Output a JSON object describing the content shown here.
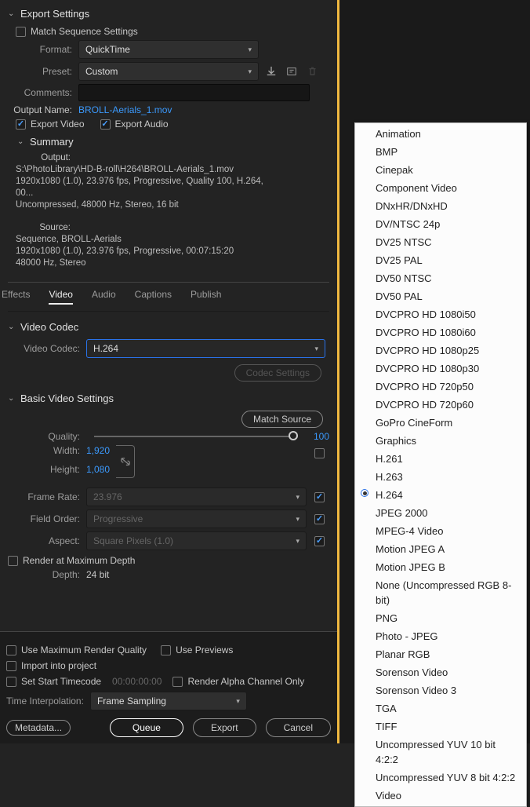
{
  "header": {
    "title": "Export Settings"
  },
  "match_sequence": {
    "label": "Match Sequence Settings",
    "checked": false
  },
  "form": {
    "format_label": "Format:",
    "format_value": "QuickTime",
    "preset_label": "Preset:",
    "preset_value": "Custom",
    "comments_label": "Comments:",
    "output_name_label": "Output Name:",
    "output_name_value": "BROLL-Aerials_1.mov",
    "export_video_label": "Export Video",
    "export_audio_label": "Export Audio"
  },
  "summary": {
    "title": "Summary",
    "output_label": "Output:",
    "output_lines": "S:\\PhotoLibrary\\HD-B-roll\\H264\\BROLL-Aerials_1.mov\n1920x1080 (1.0), 23.976 fps, Progressive, Quality 100, H.264, 00...\nUncompressed, 48000 Hz, Stereo, 16 bit",
    "source_label": "Source:",
    "source_lines": "Sequence, BROLL-Aerials\n1920x1080 (1.0), 23.976 fps, Progressive, 00:07:15:20\n48000 Hz, Stereo"
  },
  "tabs": {
    "effects": "Effects",
    "video": "Video",
    "audio": "Audio",
    "captions": "Captions",
    "publish": "Publish"
  },
  "codec_section": {
    "title": "Video Codec",
    "label": "Video Codec:",
    "value": "H.264",
    "settings_btn": "Codec Settings"
  },
  "basic": {
    "title": "Basic Video Settings",
    "match_source": "Match Source",
    "quality_label": "Quality:",
    "quality_value": "100",
    "width_label": "Width:",
    "width_value": "1,920",
    "height_label": "Height:",
    "height_value": "1,080",
    "framerate_label": "Frame Rate:",
    "framerate_value": "23.976",
    "fieldorder_label": "Field Order:",
    "fieldorder_value": "Progressive",
    "aspect_label": "Aspect:",
    "aspect_value": "Square Pixels (1.0)",
    "render_max_depth": "Render at Maximum Depth",
    "depth_label": "Depth:",
    "depth_value": "24 bit"
  },
  "footer": {
    "max_quality": "Use Maximum Render Quality",
    "use_previews": "Use Previews",
    "import_project": "Import into project",
    "set_start_tc": "Set Start Timecode",
    "start_tc_value": "00:00:00:00",
    "render_alpha": "Render Alpha Channel Only",
    "time_interp_label": "Time Interpolation:",
    "time_interp_value": "Frame Sampling",
    "metadata_btn": "Metadata...",
    "queue_btn": "Queue",
    "export_btn": "Export",
    "cancel_btn": "Cancel"
  },
  "codec_menu": {
    "selected": "H.264",
    "items": [
      "Animation",
      "BMP",
      "Cinepak",
      "Component Video",
      "DNxHR/DNxHD",
      "DV/NTSC 24p",
      "DV25 NTSC",
      "DV25 PAL",
      "DV50 NTSC",
      "DV50 PAL",
      "DVCPRO HD 1080i50",
      "DVCPRO HD 1080i60",
      "DVCPRO HD 1080p25",
      "DVCPRO HD 1080p30",
      "DVCPRO HD 720p50",
      "DVCPRO HD 720p60",
      "GoPro CineForm",
      "Graphics",
      "H.261",
      "H.263",
      "H.264",
      "JPEG 2000",
      "MPEG-4 Video",
      "Motion JPEG A",
      "Motion JPEG B",
      "None (Uncompressed RGB 8-bit)",
      "PNG",
      "Photo - JPEG",
      "Planar RGB",
      "Sorenson Video",
      "Sorenson Video 3",
      "TGA",
      "TIFF",
      "Uncompressed YUV 10 bit 4:2:2",
      "Uncompressed YUV 8 bit 4:2:2",
      "Video"
    ]
  }
}
